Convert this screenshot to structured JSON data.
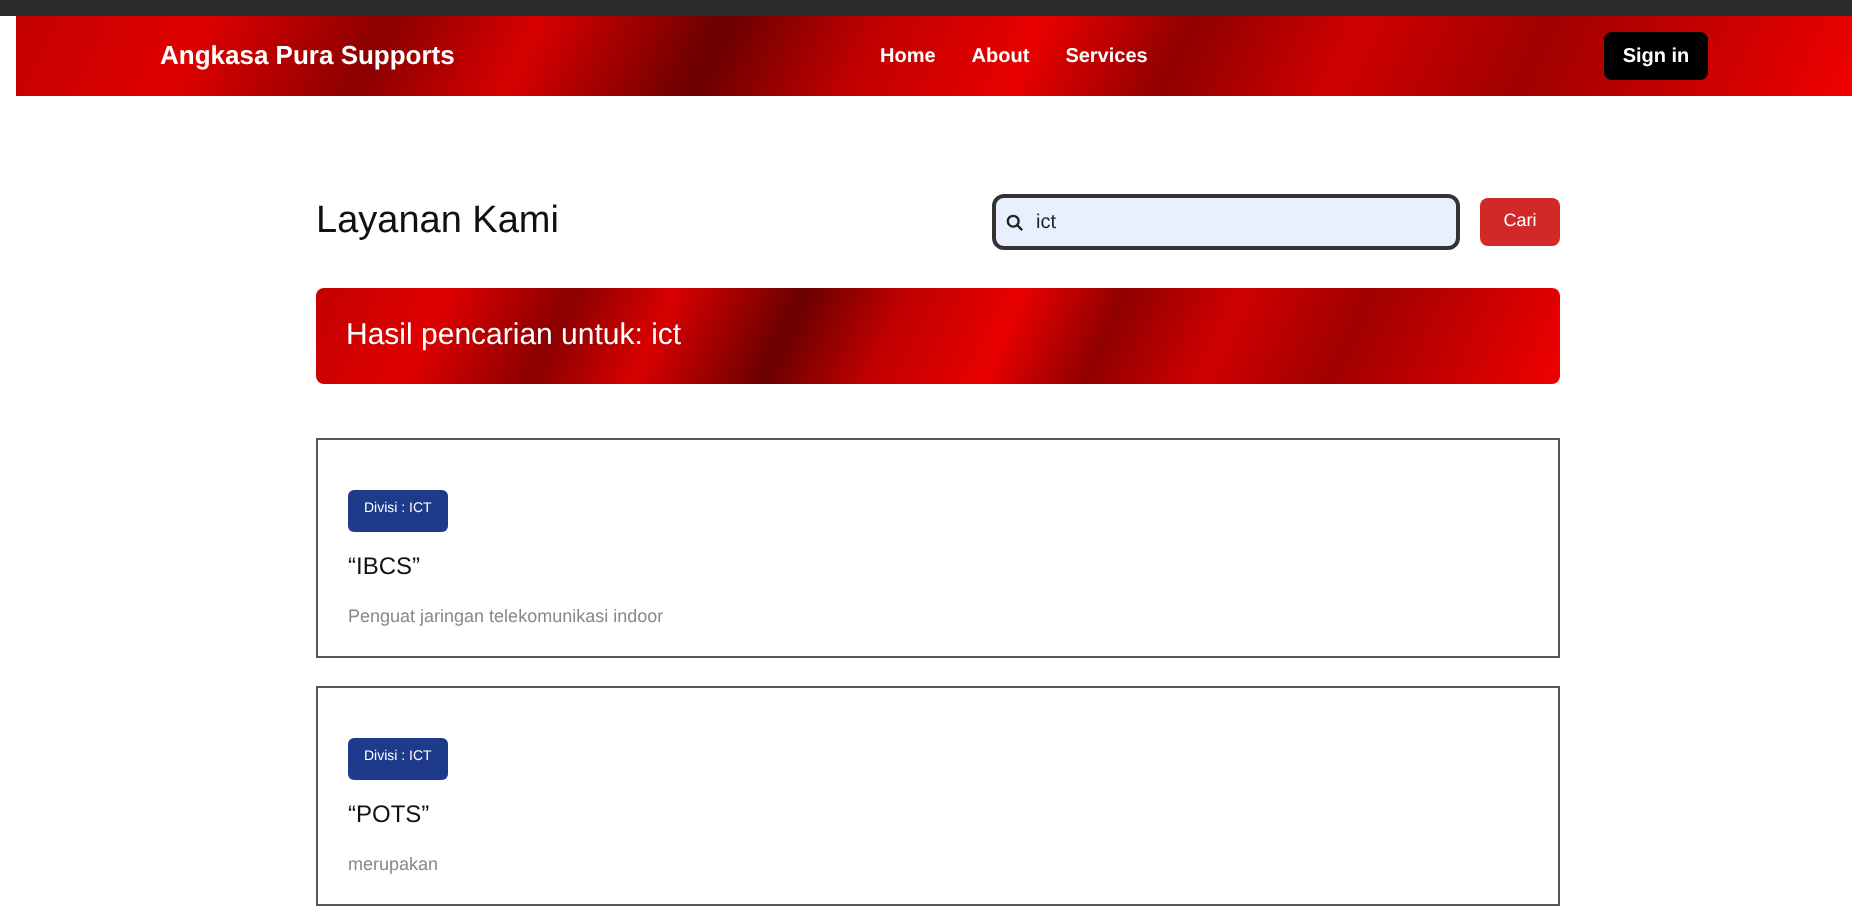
{
  "navbar": {
    "brand": "Angkasa Pura Supports",
    "links": [
      "Home",
      "About",
      "Services"
    ],
    "sign_in": "Sign in"
  },
  "page": {
    "title": "Layanan Kami",
    "search": {
      "value": "ict"
    },
    "search_button": "Cari"
  },
  "banner": {
    "text": "Hasil pencarian untuk: ict"
  },
  "services": [
    {
      "badge": "Divisi : ICT",
      "title": "“IBCS”",
      "description": "Penguat jaringan telekomunikasi indoor"
    },
    {
      "badge": "Divisi : ICT",
      "title": "“POTS”",
      "description": "merupakan"
    }
  ]
}
